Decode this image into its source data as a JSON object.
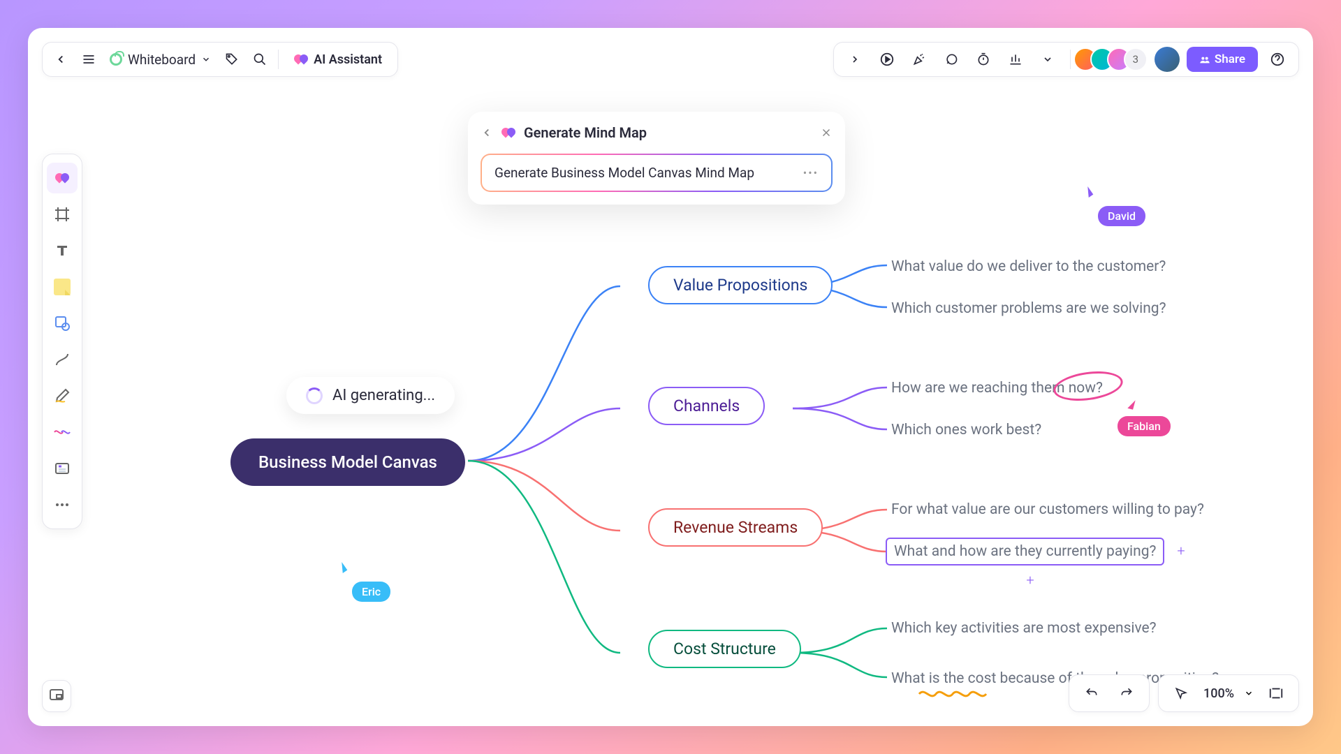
{
  "topbar": {
    "mode_label": "Whiteboard",
    "ai_assistant_label": "AI Assistant",
    "extra_avatars": "3",
    "share_label": "Share"
  },
  "ai_panel": {
    "title": "Generate Mind Map",
    "prompt": "Generate Business Model Canvas Mind Map"
  },
  "generating_badge": "AI generating...",
  "mindmap": {
    "root": "Business Model Canvas",
    "branches": {
      "value": "Value Propositions",
      "channels": "Channels",
      "revenue": "Revenue Streams",
      "cost": "Cost Structure"
    },
    "leaves": {
      "value_1": "What value do we deliver to the customer?",
      "value_2": "Which customer problems are we solving?",
      "channels_1": "How are we reaching them now?",
      "channels_2": "Which ones work best?",
      "revenue_1": "For what value are our customers willing to pay?",
      "revenue_2": "What and how are they currently paying?",
      "cost_1": "Which key activities are most expensive?",
      "cost_2": "What is the cost because of the value proposition?"
    }
  },
  "cursors": {
    "david": "David",
    "eric": "Eric",
    "fabian": "Fabian"
  },
  "zoom": "100%",
  "colors": {
    "primary": "#7c5cff",
    "root_node": "#3b2f6b",
    "branch_value": "#3b82f6",
    "branch_channels": "#8b5cf6",
    "branch_revenue": "#f87171",
    "branch_cost": "#10b981"
  }
}
